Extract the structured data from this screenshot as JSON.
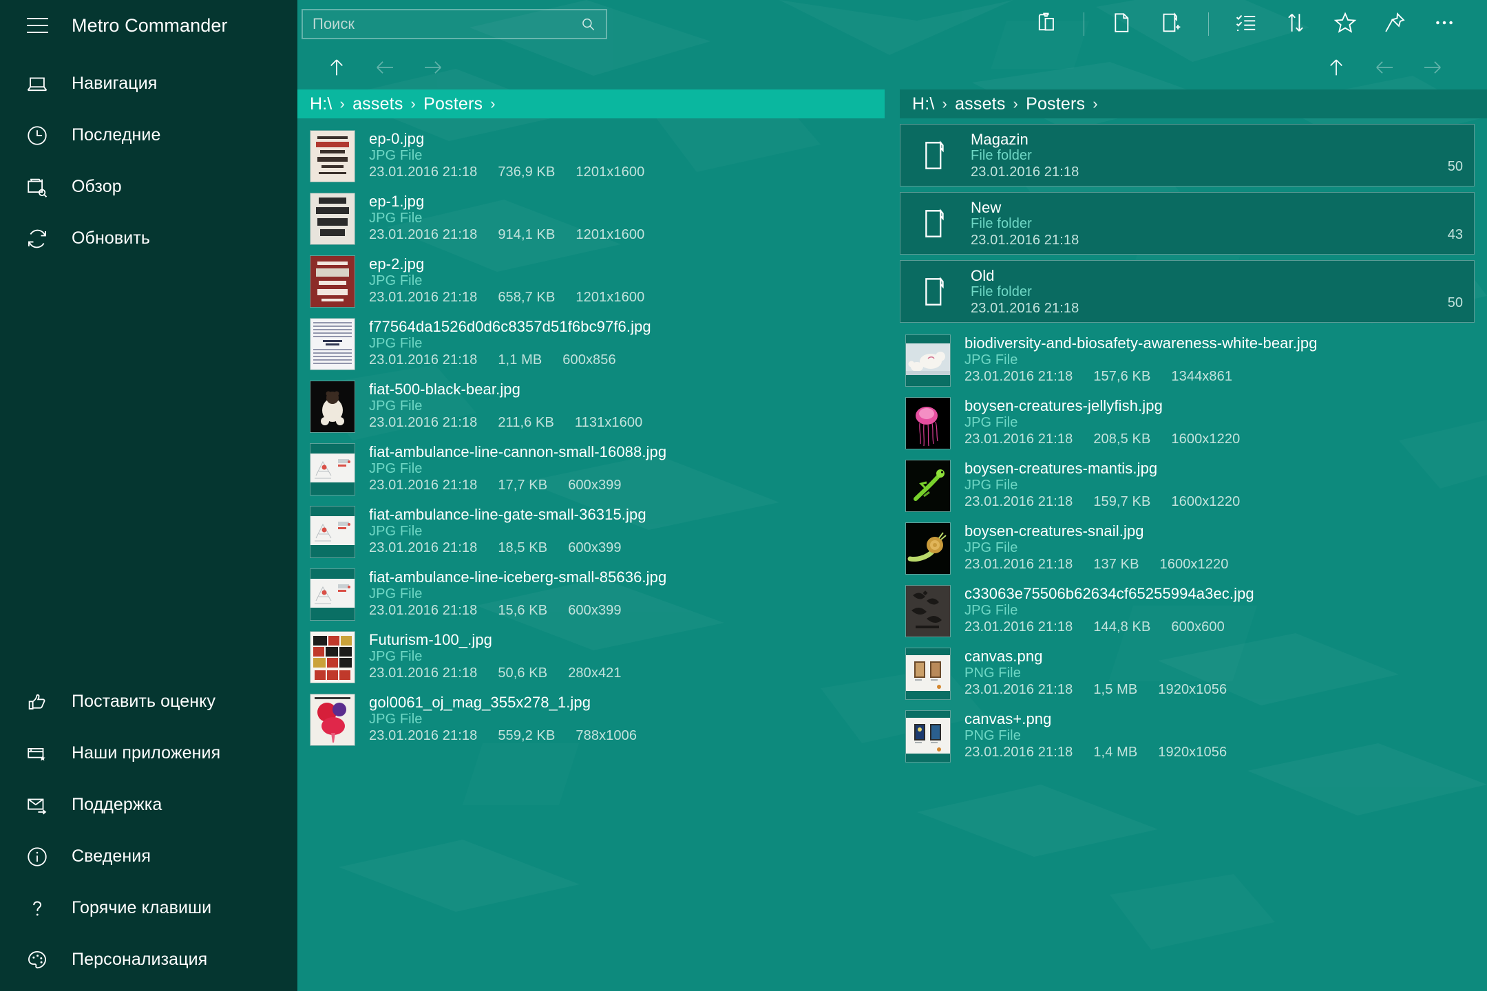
{
  "app": {
    "title": "Metro Commander",
    "accent": "#0ab79f",
    "background": "#0d8a7d",
    "sidebar_background": "#053630",
    "folder_row_background": "#0a6b61",
    "type_text_color": "#6fd7c5"
  },
  "sidebar": {
    "menu_icon": "hamburger-icon",
    "items_top": [
      {
        "label": "Навигация",
        "icon": "laptop-icon"
      },
      {
        "label": "Последние",
        "icon": "clock-icon"
      },
      {
        "label": "Обзор",
        "icon": "browse-search-icon"
      },
      {
        "label": "Обновить",
        "icon": "refresh-icon"
      }
    ],
    "items_bottom": [
      {
        "label": "Поставить оценку",
        "icon": "thumbs-up-icon"
      },
      {
        "label": "Наши приложения",
        "icon": "apps-star-icon"
      },
      {
        "label": "Поддержка",
        "icon": "mail-icon"
      },
      {
        "label": "Сведения",
        "icon": "info-icon"
      },
      {
        "label": "Горячие клавиши",
        "icon": "question-icon"
      },
      {
        "label": "Персонализация",
        "icon": "palette-icon"
      }
    ]
  },
  "search": {
    "placeholder": "Поиск",
    "value": "",
    "icon": "search-icon"
  },
  "toolbar": {
    "buttons": [
      {
        "name": "paste-button",
        "icon": "clipboard-paste-icon"
      },
      {
        "name": "new-file-button",
        "icon": "new-file-icon"
      },
      {
        "name": "new-folder-button",
        "icon": "new-folder-icon"
      },
      {
        "name": "select-items-button",
        "icon": "checklist-icon"
      },
      {
        "name": "sort-button",
        "icon": "sort-arrows-icon"
      },
      {
        "name": "favorite-button",
        "icon": "star-icon"
      },
      {
        "name": "pin-button",
        "icon": "pin-icon"
      },
      {
        "name": "more-button",
        "icon": "more-ellipsis-icon"
      }
    ]
  },
  "panels": {
    "left": {
      "active": true,
      "nav": {
        "up": "up-arrow-icon",
        "back": "back-arrow-icon",
        "forward": "forward-arrow-icon"
      },
      "breadcrumb": [
        "H:\\",
        "assets",
        "Posters"
      ],
      "breadcrumb_separator": "›",
      "items": [
        {
          "name": "ep-0.jpg",
          "type": "JPG File",
          "date": "23.01.2016 21:18",
          "size": "736,9 KB",
          "dims": "1201x1600",
          "kind": "file",
          "thumb": "poster-typography-cream"
        },
        {
          "name": "ep-1.jpg",
          "type": "JPG File",
          "date": "23.01.2016 21:18",
          "size": "914,1 KB",
          "dims": "1201x1600",
          "kind": "file",
          "thumb": "poster-australia-dark"
        },
        {
          "name": "ep-2.jpg",
          "type": "JPG File",
          "date": "23.01.2016 21:18",
          "size": "658,7 KB",
          "dims": "1201x1600",
          "kind": "file",
          "thumb": "poster-red-world"
        },
        {
          "name": "f77564da1526d0d6c8357d51f6bc97f6.jpg",
          "type": "JPG File",
          "date": "23.01.2016 21:18",
          "size": "1,1 MB",
          "dims": "600x856",
          "kind": "file",
          "thumb": "poster-speckled-white"
        },
        {
          "name": "fiat-500-black-bear.jpg",
          "type": "JPG File",
          "date": "23.01.2016 21:18",
          "size": "211,6 KB",
          "dims": "1131x1600",
          "kind": "file",
          "thumb": "photo-bear-black"
        },
        {
          "name": "fiat-ambulance-line-cannon-small-16088.jpg",
          "type": "JPG File",
          "date": "23.01.2016 21:18",
          "size": "17,7 KB",
          "dims": "600x399",
          "kind": "file",
          "thumb": "illustration-light-wide"
        },
        {
          "name": "fiat-ambulance-line-gate-small-36315.jpg",
          "type": "JPG File",
          "date": "23.01.2016 21:18",
          "size": "18,5 KB",
          "dims": "600x399",
          "kind": "file",
          "thumb": "illustration-light-wide"
        },
        {
          "name": "fiat-ambulance-line-iceberg-small-85636.jpg",
          "type": "JPG File",
          "date": "23.01.2016 21:18",
          "size": "15,6 KB",
          "dims": "600x399",
          "kind": "file",
          "thumb": "illustration-light-wide"
        },
        {
          "name": "Futurism-100_.jpg",
          "type": "JPG File",
          "date": "23.01.2016 21:18",
          "size": "50,6 KB",
          "dims": "280x421",
          "kind": "file",
          "thumb": "poster-futurism"
        },
        {
          "name": "gol0061_oj_mag_355x278_1.jpg",
          "type": "JPG File",
          "date": "23.01.2016 21:18",
          "size": "559,2 KB",
          "dims": "788x1006",
          "kind": "file",
          "thumb": "poster-balloons-red"
        }
      ]
    },
    "right": {
      "active": false,
      "nav": {
        "up": "up-arrow-icon",
        "back": "back-arrow-icon",
        "forward": "forward-arrow-icon"
      },
      "breadcrumb": [
        "H:\\",
        "assets",
        "Posters"
      ],
      "breadcrumb_separator": "›",
      "items": [
        {
          "name": "Magazin",
          "type": "File folder",
          "date": "23.01.2016 21:18",
          "count": "50",
          "kind": "folder",
          "icon": "folder-icon"
        },
        {
          "name": "New",
          "type": "File folder",
          "date": "23.01.2016 21:18",
          "count": "43",
          "kind": "folder",
          "icon": "folder-icon"
        },
        {
          "name": "Old",
          "type": "File folder",
          "date": "23.01.2016 21:18",
          "count": "50",
          "kind": "folder",
          "icon": "folder-icon"
        },
        {
          "name": "biodiversity-and-biosafety-awareness-white-bear.jpg",
          "type": "JPG File",
          "date": "23.01.2016 21:18",
          "size": "157,6 KB",
          "dims": "1344x861",
          "kind": "file",
          "thumb": "photo-polar-bears"
        },
        {
          "name": "boysen-creatures-jellyfish.jpg",
          "type": "JPG File",
          "date": "23.01.2016 21:18",
          "size": "208,5 KB",
          "dims": "1600x1220",
          "kind": "file",
          "thumb": "photo-jellyfish"
        },
        {
          "name": "boysen-creatures-mantis.jpg",
          "type": "JPG File",
          "date": "23.01.2016 21:18",
          "size": "159,7 KB",
          "dims": "1600x1220",
          "kind": "file",
          "thumb": "photo-mantis"
        },
        {
          "name": "boysen-creatures-snail.jpg",
          "type": "JPG File",
          "date": "23.01.2016 21:18",
          "size": "137 KB",
          "dims": "1600x1220",
          "kind": "file",
          "thumb": "photo-snail"
        },
        {
          "name": "c33063e75506b62634cf65255994a3ec.jpg",
          "type": "JPG File",
          "date": "23.01.2016 21:18",
          "size": "144,8 KB",
          "dims": "600x600",
          "kind": "file",
          "thumb": "poster-lettering-dark"
        },
        {
          "name": "canvas.png",
          "type": "PNG File",
          "date": "23.01.2016 21:18",
          "size": "1,5 MB",
          "dims": "1920x1056",
          "kind": "file",
          "thumb": "gallery-two-frames"
        },
        {
          "name": "canvas+.png",
          "type": "PNG File",
          "date": "23.01.2016 21:18",
          "size": "1,4 MB",
          "dims": "1920x1056",
          "kind": "file",
          "thumb": "gallery-two-frames-blue"
        }
      ]
    }
  }
}
